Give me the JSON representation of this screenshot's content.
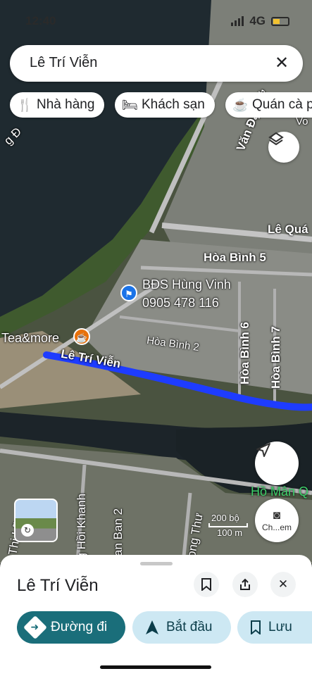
{
  "status": {
    "time": "12:40",
    "network": "4G"
  },
  "search": {
    "query": "Lê Trí Viễn"
  },
  "chips": [
    {
      "icon": "restaurant-icon",
      "label": "Nhà hàng"
    },
    {
      "icon": "hotel-icon",
      "label": "Khách sạn"
    },
    {
      "icon": "coffee-icon",
      "label": "Quán cà p"
    }
  ],
  "map": {
    "streets": [
      "Văn Đại Nữ",
      "Lê Quá",
      "Hòa Bình 5",
      "Hòa Bình 6",
      "Hòa Bình 7",
      "Hòa Bình 2",
      "Lê Trí Viễn",
      "ng Hồi Khanh",
      "an Ban 2",
      "ong Thư",
      "n Thị Lữ",
      "g Đ",
      "Vo"
    ],
    "places": [
      {
        "name": "BĐS Hùng Vinh",
        "phone": "0905 478 116"
      },
      {
        "name": "Tea&more"
      },
      {
        "name": "Hồ Mân Q"
      }
    ],
    "scale": {
      "top": "200 bộ",
      "bottom": "100 m"
    },
    "layers_label": "layers",
    "lens_label": "Ch...em"
  },
  "sheet": {
    "title": "Lê Trí Viễn",
    "actions": {
      "directions": "Đường đi",
      "start": "Bắt đầu",
      "save": "Lưu"
    }
  },
  "colors": {
    "route": "#1e3cff",
    "primary": "#1a6e7a",
    "secondary": "#cde8f3"
  }
}
